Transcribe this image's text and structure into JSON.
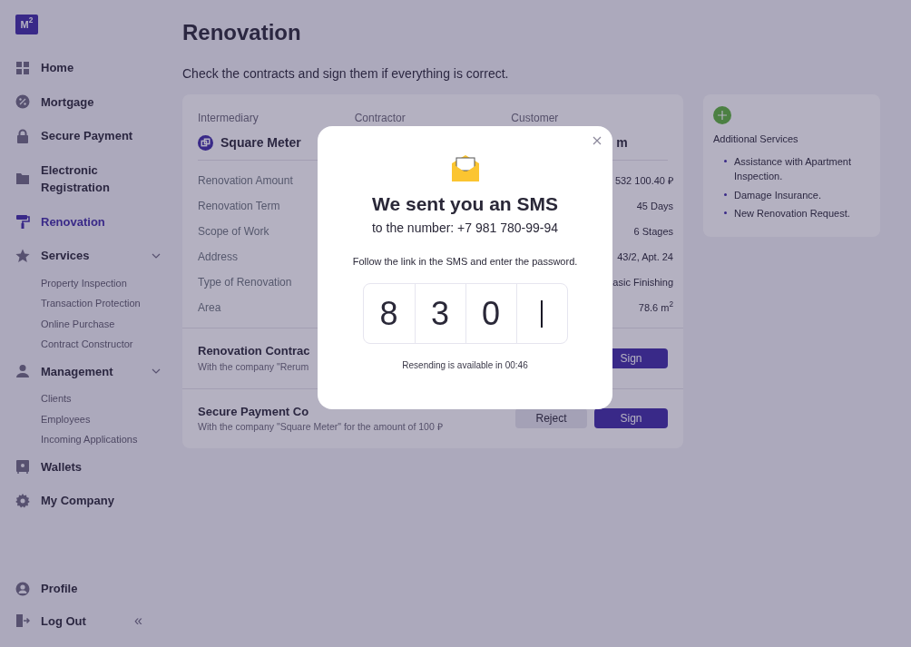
{
  "logo": "M$^{2}$",
  "nav": [
    {
      "label": "Home",
      "selected": false
    },
    {
      "label": "Mortgage",
      "selected": false
    },
    {
      "label": "Secure Payment",
      "selected": false
    },
    {
      "label": "Electronic Registration",
      "selected": false
    },
    {
      "label": "Renovation",
      "selected": true
    },
    {
      "label": "Services",
      "selected": false,
      "expanded": true,
      "children": [
        {
          "label": "Property Inspection"
        },
        {
          "label": "Transaction Protection"
        },
        {
          "label": "Online Purchase"
        },
        {
          "label": "Contract Constructor"
        }
      ]
    },
    {
      "label": "Management",
      "selected": false,
      "expanded": true,
      "children": [
        {
          "label": "Clients"
        },
        {
          "label": "Employees"
        },
        {
          "label": "Incoming Applications"
        }
      ]
    },
    {
      "label": "Wallets",
      "selected": false
    },
    {
      "label": "My Company",
      "selected": false
    }
  ],
  "footer": [
    {
      "label": "Profile"
    },
    {
      "label": "Log Out",
      "collapse": "«"
    }
  ],
  "title": "Renovation",
  "subtitle": "Check the contracts and sign them if everything is correct.",
  "parties": [
    {
      "label": "Intermediary",
      "value": "Square Meter",
      "logo": true
    },
    {
      "label": "Contractor"
    },
    {
      "label": "Customer",
      "value": "m"
    }
  ],
  "details": [
    {
      "label": "Renovation Amount",
      "value": "532 100.40 ₽"
    },
    {
      "label": "Renovation Term",
      "value": "45 Days"
    },
    {
      "label": "Scope of Work",
      "value": "6 Stages"
    },
    {
      "label": "Address",
      "value": "43/2, Apt. 24"
    },
    {
      "label": "Type of Renovation",
      "value": "asic Finishing"
    },
    {
      "label": "Area",
      "value": "78.6 m$^{2}$"
    }
  ],
  "contracts": [
    {
      "title": "Renovation Contrac",
      "subtitle": "With the company \"Rerum",
      "buttons": [
        {
          "label": "Sign",
          "kind": "primary"
        }
      ]
    },
    {
      "title": "Secure Payment Co",
      "subtitle": "With the company \"Square Meter\" for the amount of 100 ₽",
      "buttons": [
        {
          "label": "Reject",
          "kind": "secondary"
        },
        {
          "label": "Sign",
          "kind": "primary"
        }
      ]
    }
  ],
  "services": {
    "title": "Additional Services",
    "items": [
      "Assistance with Apartment Inspection.",
      "Damage Insurance.",
      "New Renovation Request."
    ]
  },
  "modal": {
    "title": "We sent you an SMS",
    "phone": "to the number: +7 981 780-99-94",
    "instruction": "Follow the link in the SMS and enter the password.",
    "cells": [
      {
        "digit": "8",
        "focused": false
      },
      {
        "digit": "3",
        "focused": false
      },
      {
        "digit": "0",
        "focused": false
      },
      {
        "focused": true
      }
    ],
    "timer": "Resending is available in 00:46"
  }
}
